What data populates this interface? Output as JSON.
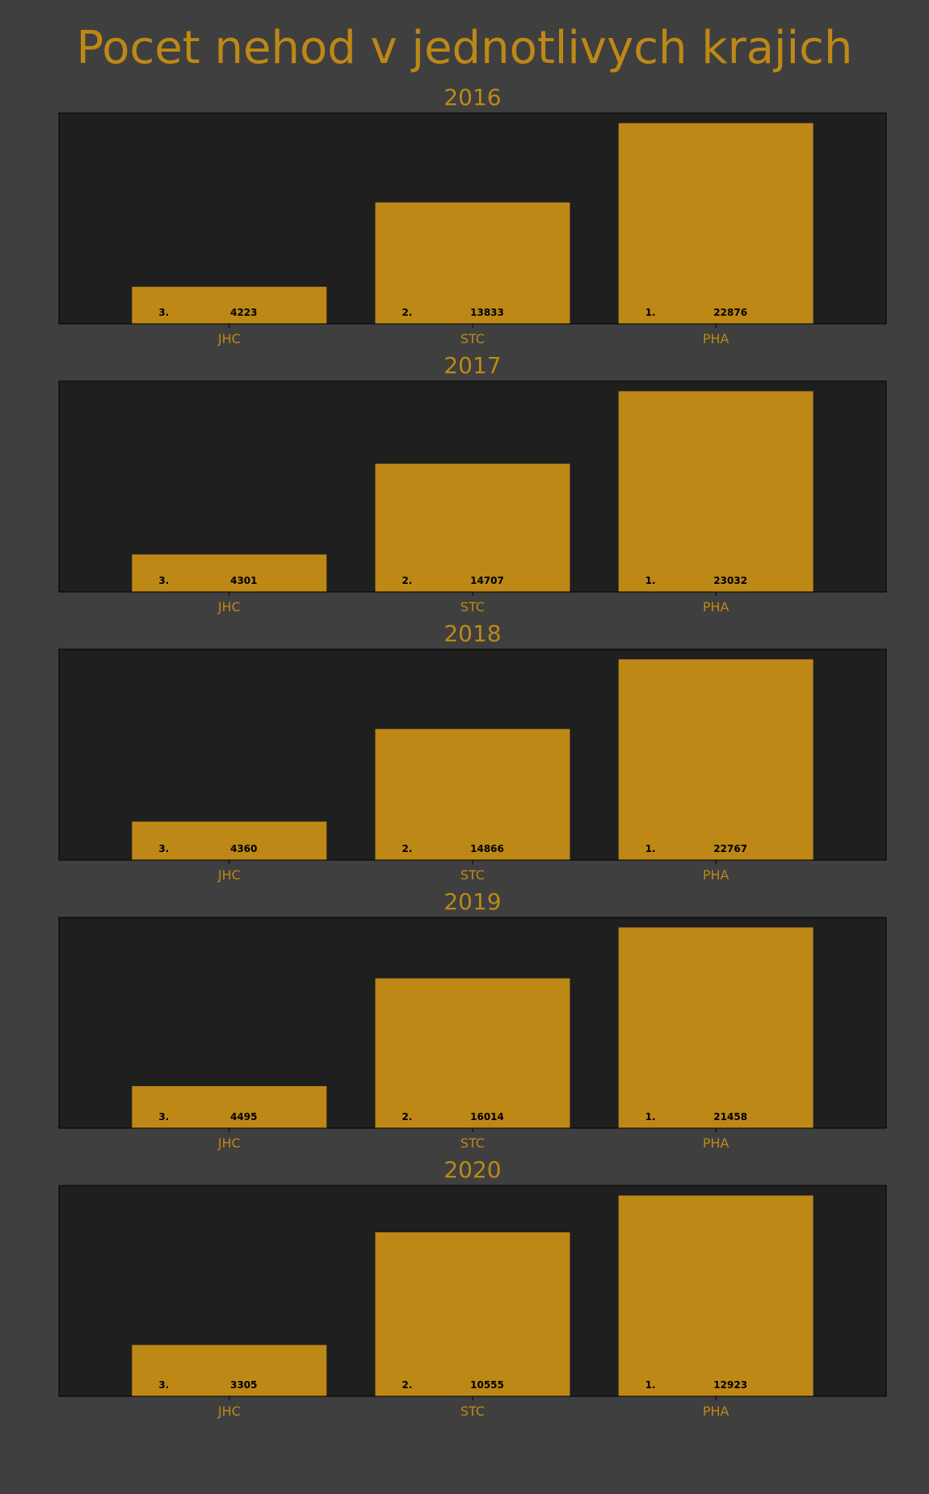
{
  "title": "Pocet nehod v jednotlivych krajich",
  "colors": {
    "background": "#3f3f3f",
    "axes_background": "#1f1f1f",
    "bar": "#bd8815",
    "text": "#bd8815",
    "label_text": "#000000"
  },
  "chart_data": [
    {
      "type": "bar",
      "title": "2016",
      "categories": [
        "JHC",
        "STC",
        "PHA"
      ],
      "values": [
        4223,
        13833,
        22876
      ],
      "ranks": [
        "3.",
        "2.",
        "1."
      ]
    },
    {
      "type": "bar",
      "title": "2017",
      "categories": [
        "JHC",
        "STC",
        "PHA"
      ],
      "values": [
        4301,
        14707,
        23032
      ],
      "ranks": [
        "3.",
        "2.",
        "1."
      ]
    },
    {
      "type": "bar",
      "title": "2018",
      "categories": [
        "JHC",
        "STC",
        "PHA"
      ],
      "values": [
        4360,
        14866,
        22767
      ],
      "ranks": [
        "3.",
        "2.",
        "1."
      ]
    },
    {
      "type": "bar",
      "title": "2019",
      "categories": [
        "JHC",
        "STC",
        "PHA"
      ],
      "values": [
        4495,
        16014,
        21458
      ],
      "ranks": [
        "3.",
        "2.",
        "1."
      ]
    },
    {
      "type": "bar",
      "title": "2020",
      "categories": [
        "JHC",
        "STC",
        "PHA"
      ],
      "values": [
        3305,
        10555,
        12923
      ],
      "ranks": [
        "3.",
        "2.",
        "1."
      ]
    }
  ]
}
